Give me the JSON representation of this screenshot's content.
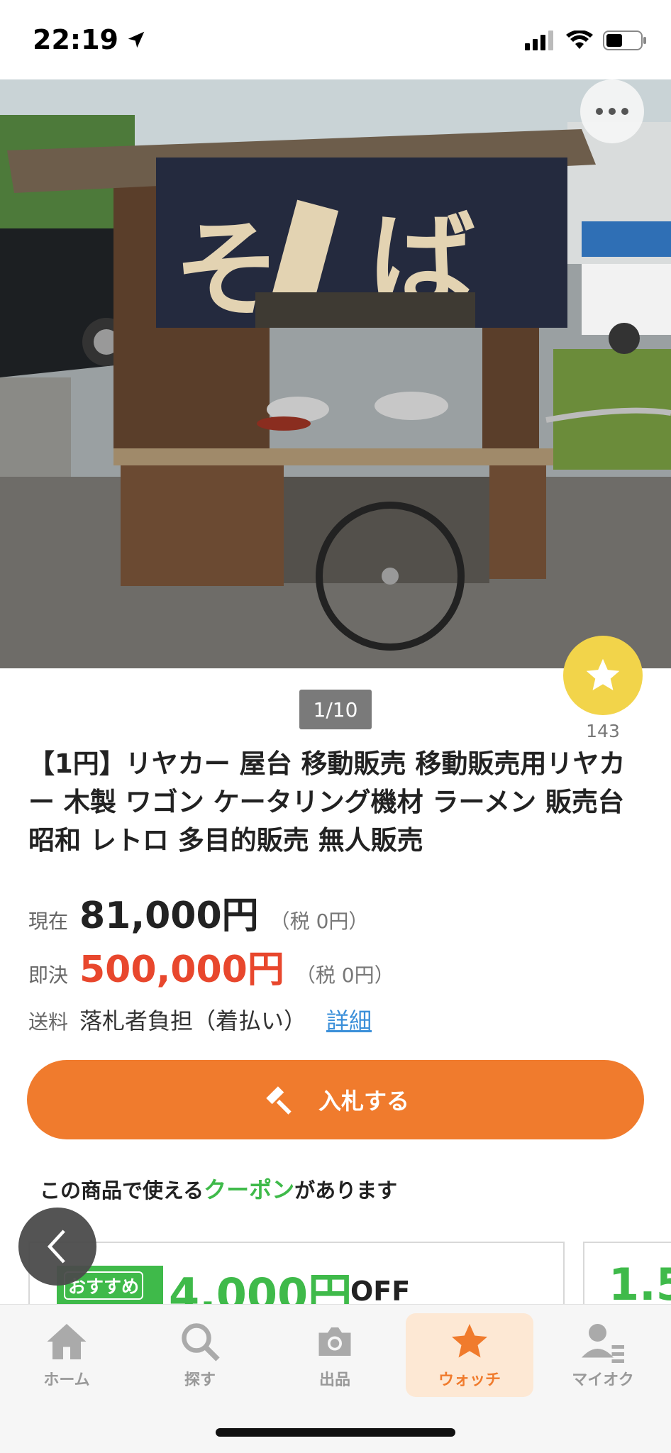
{
  "status_bar": {
    "time": "22:19"
  },
  "gallery": {
    "page_indicator": "1/10",
    "watch_count": "143",
    "more_label": ""
  },
  "listing": {
    "title": "【1円】リヤカー 屋台 移動販売 移動販売用リヤカー 木製 ワゴン ケータリング機材 ラーメン 販売台 昭和 レトロ 多目的販売 無人販売",
    "current_label": "現在",
    "current_price": "81,000円",
    "current_tax": "（税 0円）",
    "buyout_label": "即決",
    "buyout_price": "500,000円",
    "buyout_tax": "（税 0円）",
    "shipping_label": "送料",
    "shipping_value": "落札者負担（着払い）",
    "shipping_detail_link": "詳細"
  },
  "bid_button": {
    "label": "入札する"
  },
  "coupon": {
    "heading_pre": "この商品で使える",
    "heading_highlight": "クーポン",
    "heading_post": "があります",
    "cards": [
      {
        "badge": "おすすめ",
        "amount": "4,000円",
        "suffix": "OFF"
      },
      {
        "amount": "1.5"
      }
    ]
  },
  "bottom_nav": {
    "items": [
      {
        "label": "ホーム",
        "icon": "home-icon"
      },
      {
        "label": "探す",
        "icon": "search-icon"
      },
      {
        "label": "出品",
        "icon": "camera-icon"
      },
      {
        "label": "ウォッチ",
        "icon": "star-icon",
        "active": true
      },
      {
        "label": "マイオク",
        "icon": "user-list-icon"
      }
    ]
  },
  "colors": {
    "accent": "#f07b2d",
    "buyout": "#e8472d",
    "coupon_green": "#3fba4a",
    "watch_star": "#f2d44a",
    "link": "#3b8fd9"
  }
}
